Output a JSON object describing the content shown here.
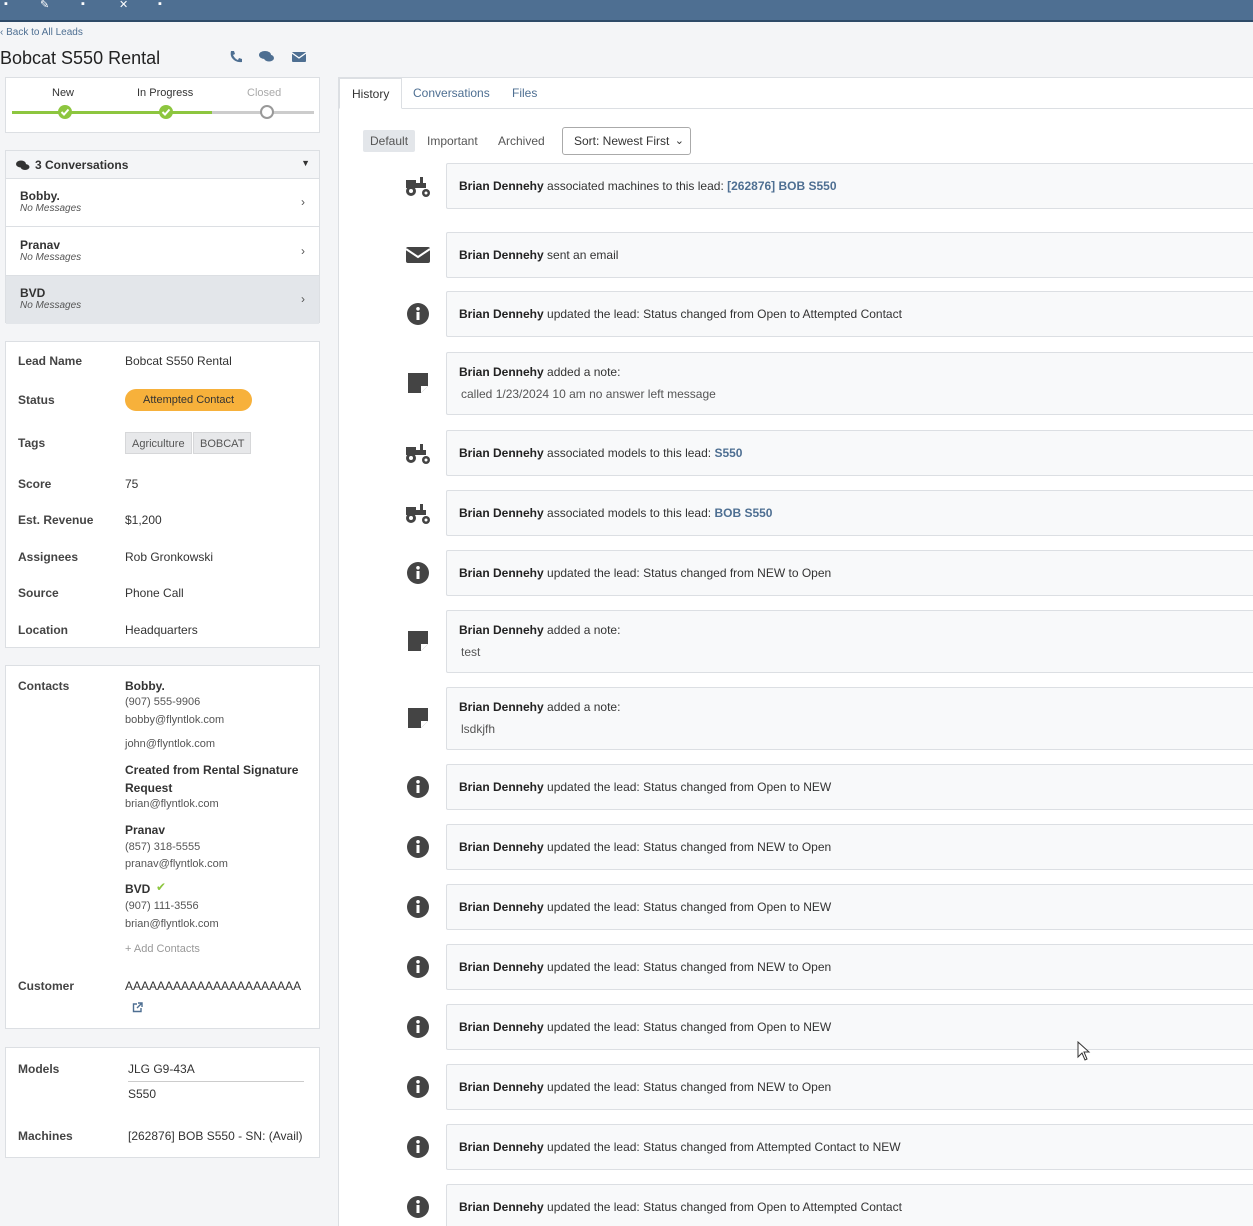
{
  "header": {
    "back_link": "Back to All Leads",
    "title": "Bobcat S550 Rental"
  },
  "stages": {
    "items": [
      {
        "label": "New",
        "done": true
      },
      {
        "label": "In Progress",
        "done": true
      },
      {
        "label": "Closed",
        "done": false
      }
    ],
    "accent": "#8dc63f"
  },
  "conversations": {
    "heading": "3 Conversations",
    "items": [
      {
        "name": "Bobby.",
        "sub": "No Messages"
      },
      {
        "name": "Pranav",
        "sub": "No Messages"
      },
      {
        "name": "BVD",
        "sub": "No Messages"
      }
    ]
  },
  "lead": {
    "lead_name_label": "Lead Name",
    "lead_name": "Bobcat S550 Rental",
    "status_label": "Status",
    "status": "Attempted Contact",
    "status_color": "#f7b13b",
    "tags_label": "Tags",
    "tags": [
      "Agriculture",
      "BOBCAT"
    ],
    "score_label": "Score",
    "score": "75",
    "revenue_label": "Est. Revenue",
    "revenue": "$1,200",
    "assignees_label": "Assignees",
    "assignees": "Rob Gronkowski",
    "source_label": "Source",
    "source": "Phone Call",
    "location_label": "Location",
    "location": "Headquarters"
  },
  "contacts": {
    "label": "Contacts",
    "items": [
      {
        "name": "Bobby.",
        "phone": "(907) 555-9906",
        "email": "bobby@flyntlok.com",
        "email2": "john@flyntlok.com"
      },
      {
        "name": "Created from Rental Signature",
        "name2": "Request",
        "email": "brian@flyntlok.com"
      },
      {
        "name": "Pranav",
        "phone": "(857) 318-5555",
        "email": "pranav@flyntlok.com"
      },
      {
        "name": "BVD",
        "phone": "(907) 111-3556",
        "email": "brian@flyntlok.com"
      }
    ],
    "add_label": "+ Add Contacts",
    "customer_label": "Customer",
    "customer": "AAAAAAAAAAAAAAAAAAAAAA"
  },
  "equipment": {
    "models_label": "Models",
    "models": [
      "JLG G9-43A",
      "S550"
    ],
    "machines_label": "Machines",
    "machines": "[262876] BOB S550 - SN: (Avail)"
  },
  "tabs": [
    "History",
    "Conversations",
    "Files"
  ],
  "filters": [
    "Default",
    "Important",
    "Archived"
  ],
  "sort": "Sort: Newest First",
  "history": [
    {
      "icon": "tractor-icon",
      "who": "Brian Dennehy",
      "text": " associated machines to this lead: ",
      "link": "[262876] BOB S550"
    },
    {
      "icon": "envelope-icon",
      "who": "Brian Dennehy",
      "text": " sent an email"
    },
    {
      "icon": "info-icon",
      "who": "Brian Dennehy",
      "text": " updated the lead: Status changed from Open to Attempted Contact"
    },
    {
      "icon": "note-icon",
      "who": "Brian Dennehy",
      "text": " added a note:",
      "note": "called 1/23/2024 10 am no answer left message"
    },
    {
      "icon": "tractor-icon",
      "who": "Brian Dennehy",
      "text": " associated models to this lead: ",
      "link": "S550"
    },
    {
      "icon": "tractor-icon",
      "who": "Brian Dennehy",
      "text": " associated models to this lead: ",
      "link": "BOB S550"
    },
    {
      "icon": "info-icon",
      "who": "Brian Dennehy",
      "text": " updated the lead: Status changed from NEW to Open"
    },
    {
      "icon": "note-icon",
      "who": "Brian Dennehy",
      "text": " added a note:",
      "note": "test"
    },
    {
      "icon": "note-icon",
      "who": "Brian Dennehy",
      "text": " added a note:",
      "note": "lsdkjfh"
    },
    {
      "icon": "info-icon",
      "who": "Brian Dennehy",
      "text": " updated the lead: Status changed from Open to NEW"
    },
    {
      "icon": "info-icon",
      "who": "Brian Dennehy",
      "text": " updated the lead: Status changed from NEW to Open"
    },
    {
      "icon": "info-icon",
      "who": "Brian Dennehy",
      "text": " updated the lead: Status changed from Open to NEW"
    },
    {
      "icon": "info-icon",
      "who": "Brian Dennehy",
      "text": " updated the lead: Status changed from NEW to Open"
    },
    {
      "icon": "info-icon",
      "who": "Brian Dennehy",
      "text": " updated the lead: Status changed from Open to NEW"
    },
    {
      "icon": "info-icon",
      "who": "Brian Dennehy",
      "text": " updated the lead: Status changed from NEW to Open"
    },
    {
      "icon": "info-icon",
      "who": "Brian Dennehy",
      "text": " updated the lead: Status changed from Attempted Contact to NEW"
    },
    {
      "icon": "info-icon",
      "who": "Brian Dennehy",
      "text": " updated the lead: Status changed from Open to Attempted Contact"
    }
  ]
}
